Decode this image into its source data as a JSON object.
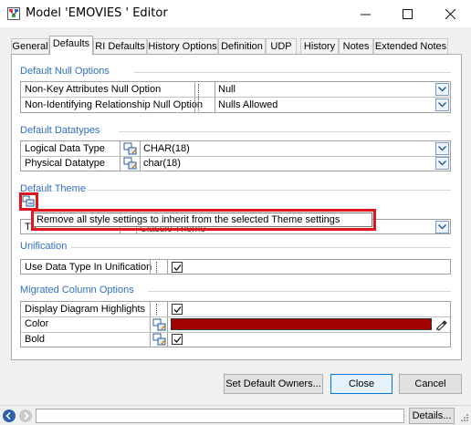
{
  "window": {
    "title": "Model 'EMOVIES                ' Editor",
    "minimize_icon": "minimize-icon",
    "maximize_icon": "maximize-icon",
    "close_icon": "close-icon"
  },
  "tabs": [
    {
      "label": "General"
    },
    {
      "label": "Defaults",
      "active": true
    },
    {
      "label": "RI Defaults"
    },
    {
      "label": "History Options"
    },
    {
      "label": "Definition"
    },
    {
      "label": "UDP"
    },
    {
      "label": "History"
    },
    {
      "label": "Notes"
    },
    {
      "label": "Extended Notes"
    }
  ],
  "null_options": {
    "title": "Default Null Options",
    "rows": [
      {
        "label": "Non-Key Attributes Null Option",
        "value": "Null"
      },
      {
        "label": "Non-Identifying Relationship Null Option",
        "value": "Nulls Allowed"
      }
    ]
  },
  "datatypes": {
    "title": "Default Datatypes",
    "rows": [
      {
        "label": "Logical Data Type",
        "value": "CHAR(18)"
      },
      {
        "label": "Physical Datatype",
        "value": "char(18)"
      }
    ]
  },
  "theme": {
    "title": "Default Theme",
    "row_label_partial": "Th",
    "row_value_partial": "Classic Theme",
    "tooltip": "Remove all style settings to inherit from the selected Theme settings"
  },
  "unification": {
    "title": "Unification",
    "rows": [
      {
        "label": "Use Data Type In Unification",
        "checked": true
      }
    ]
  },
  "migrated": {
    "title": "Migrated Column Options",
    "rows": [
      {
        "label": "Display Diagram Highlights",
        "checked": true
      },
      {
        "label": "Color",
        "color": "#a30000"
      },
      {
        "label": "Bold",
        "checked": true
      }
    ]
  },
  "buttons": {
    "set_default_owners": "Set Default Owners...",
    "close": "Close",
    "cancel": "Cancel",
    "details": "Details..."
  },
  "colors": {
    "accent_blue": "#2f6fc2",
    "highlight_red": "#e0161e",
    "swatch": "#a30000"
  }
}
